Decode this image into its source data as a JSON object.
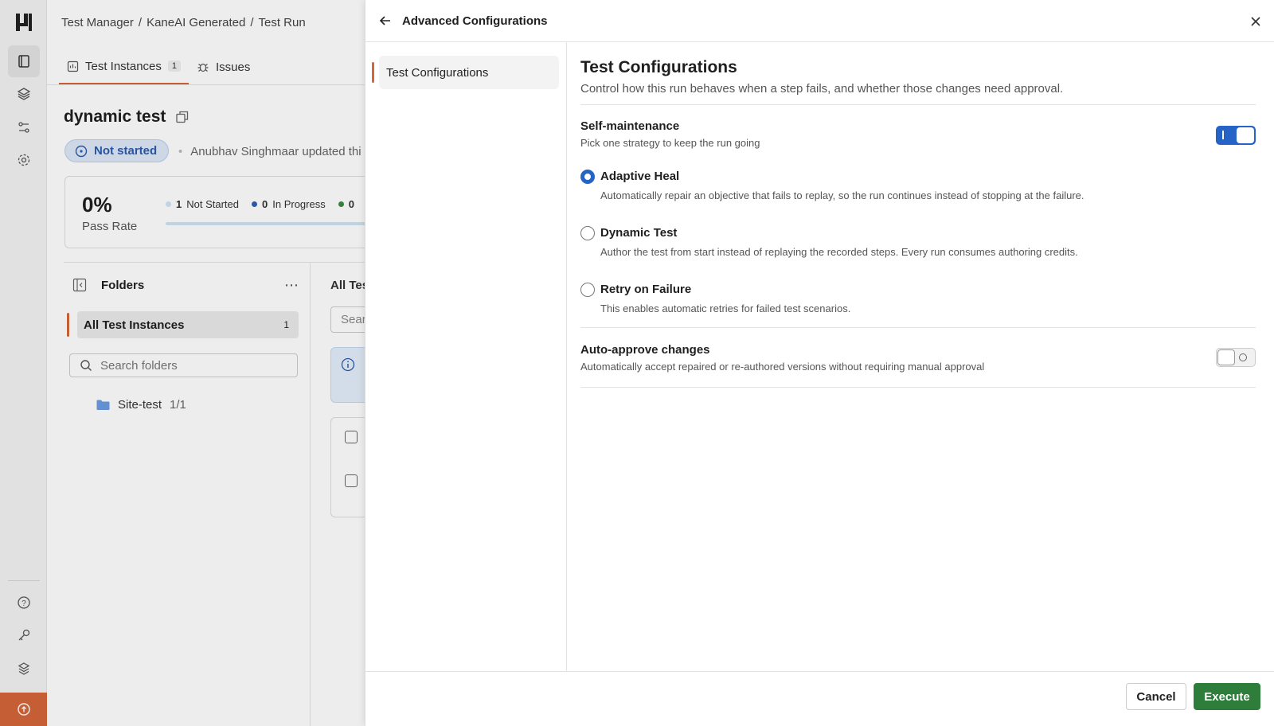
{
  "breadcrumb": [
    "Test Manager",
    "KaneAI Generated",
    "Test Run"
  ],
  "tabs": [
    {
      "label": "Test Instances",
      "count": "1"
    },
    {
      "label": "Issues"
    }
  ],
  "page": {
    "title": "dynamic test",
    "status": "Not started",
    "updated_text": "Anubhav Singhmaar updated thi"
  },
  "stats": {
    "pass_rate": "0%",
    "pass_rate_label": "Pass Rate",
    "legend": [
      {
        "count": "1",
        "label": "Not Started",
        "color": "#cfe3f4"
      },
      {
        "count": "0",
        "label": "In Progress",
        "color": "#2f5fb5"
      },
      {
        "count": "0",
        "label": "",
        "color": "#3a8a3f"
      }
    ]
  },
  "folders": {
    "title": "Folders",
    "all_instances": "All Test Instances",
    "all_instances_count": "1",
    "search_placeholder": "Search folders",
    "items": [
      {
        "name": "Site-test",
        "count": "1/1"
      }
    ]
  },
  "tests_panel": {
    "title": "All Tes",
    "search_placeholder": "Sear"
  },
  "drawer": {
    "title": "Advanced Configurations",
    "nav": [
      "Test Configurations"
    ],
    "heading": "Test Configurations",
    "subheading": "Control how this run behaves when a step fails, and whether those changes need approval.",
    "self_maintenance": {
      "title": "Self-maintenance",
      "desc": "Pick one strategy to keep the run going",
      "enabled": true
    },
    "options": [
      {
        "label": "Adaptive Heal",
        "desc": "Automatically repair an objective that fails to replay, so the run continues instead of stopping at the failure.",
        "selected": true
      },
      {
        "label": "Dynamic Test",
        "desc": "Author the test from start instead of replaying the recorded steps. Every run consumes authoring credits.",
        "selected": false
      },
      {
        "label": "Retry on Failure",
        "desc": "This enables automatic retries for failed test scenarios.",
        "selected": false
      }
    ],
    "auto_approve": {
      "title": "Auto-approve changes",
      "desc": "Automatically accept repaired or re-authored versions without requiring manual approval",
      "enabled": false
    },
    "cancel_label": "Cancel",
    "execute_label": "Execute"
  },
  "colors": {
    "accent": "#d5663a",
    "primary": "#2563c7",
    "execute": "#2f7d3a"
  }
}
